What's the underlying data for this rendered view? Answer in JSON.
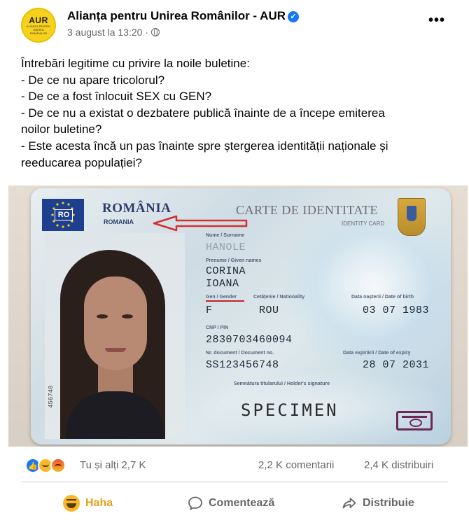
{
  "post": {
    "page_name": "Alianța pentru Unirea Românilor - AUR",
    "timestamp": "3 august la 13:20",
    "separator": "·",
    "avatar": {
      "logo_text": "AUR",
      "logo_subtitle": "ALIANȚA PENTRU UNIREA ROMÂNILOR"
    },
    "verified_icon": "check-badge-icon",
    "privacy_icon": "globe-icon",
    "more_icon": "more-horizontal-icon",
    "text_lines": [
      "Întrebări legitime cu privire la noile buletine:",
      "- De ce nu apare tricolorul?",
      "- De ce a fost înlocuit SEX cu GEN?",
      "- De ce nu a existat o dezbatere publică înainte de a începe emiterea",
      "noilor buletine?",
      "- Este acesta încă un pas înainte spre ștergerea identității naționale și",
      "reeducarea populației?"
    ]
  },
  "id_card": {
    "eu_code": "RO",
    "country": "ROMÂNIA",
    "country_en": "ROMANIA",
    "doc_title": "CARTE DE IDENTITATE",
    "doc_title_en": "IDENTITY CARD",
    "surname_label": "Nume / Surname",
    "surname": "HANOLE",
    "given_label": "Prenume / Given names",
    "given_1": "CORINA",
    "given_2": "IOANA",
    "gender_label": "Gen / Gender",
    "gender": "F",
    "nationality_label": "Cetățenie / Nationality",
    "nationality": "ROU",
    "birth_label": "Data nașterii / Date of birth",
    "birth": "03 07 1983",
    "cnp_label": "CNP / PIN",
    "cnp": "2830703460094",
    "docno_label": "Nr. document / Document no.",
    "docno": "SS123456748",
    "expiry_label": "Data expirării / Date of expiry",
    "expiry": "28 07 2031",
    "signature_label": "Semnătura titularului / Holder's signature",
    "signature": "SPECIMEN",
    "vertical_number": "456748"
  },
  "stats": {
    "reaction_icons": [
      "like-icon",
      "haha-icon",
      "angry-icon"
    ],
    "reactions_text": "Tu și alți 2,7 K",
    "comments_text": "2,2 K comentarii",
    "shares_text": "2,4 K distribuiri"
  },
  "actions": {
    "haha_label": "Haha",
    "comment_label": "Comentează",
    "share_label": "Distribuie"
  },
  "colors": {
    "facebook_blue": "#1877f2",
    "haha_yellow": "#f7b928",
    "haha_text": "#e3a11e",
    "secondary_text": "#65676b"
  }
}
